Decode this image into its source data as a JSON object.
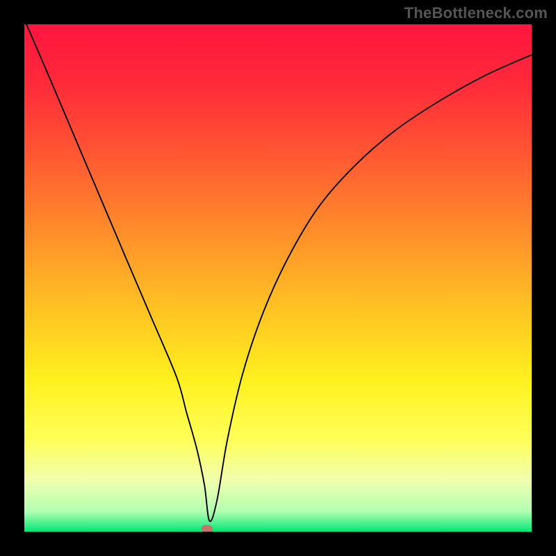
{
  "watermark": "TheBottleneck.com",
  "chart_data": {
    "type": "line",
    "title": "",
    "xlabel": "",
    "ylabel": "",
    "xlim": [
      0,
      1000
    ],
    "ylim": [
      0,
      1000
    ],
    "grid": false,
    "background": {
      "type": "vertical-gradient",
      "stops": [
        {
          "offset": 0.0,
          "color": "#ff153f"
        },
        {
          "offset": 0.12,
          "color": "#ff2b3a"
        },
        {
          "offset": 0.25,
          "color": "#ff5533"
        },
        {
          "offset": 0.4,
          "color": "#ff8a2b"
        },
        {
          "offset": 0.55,
          "color": "#ffbf24"
        },
        {
          "offset": 0.7,
          "color": "#fff01f"
        },
        {
          "offset": 0.82,
          "color": "#ffff5a"
        },
        {
          "offset": 0.9,
          "color": "#f0ffb0"
        },
        {
          "offset": 0.96,
          "color": "#b2ffb2"
        },
        {
          "offset": 1.0,
          "color": "#00e676"
        }
      ]
    },
    "series": [
      {
        "name": "curve",
        "x": [
          0,
          50,
          100,
          150,
          200,
          250,
          300,
          320,
          340,
          355,
          365,
          380,
          400,
          430,
          470,
          520,
          580,
          650,
          730,
          820,
          910,
          1000
        ],
        "y": [
          1010,
          894,
          776,
          658,
          540,
          423,
          305,
          234,
          163,
          92,
          21,
          63,
          180,
          310,
          430,
          540,
          640,
          720,
          790,
          850,
          900,
          940
        ]
      }
    ],
    "marker": {
      "x": 360,
      "y": 5,
      "color": "#c4746a"
    }
  }
}
